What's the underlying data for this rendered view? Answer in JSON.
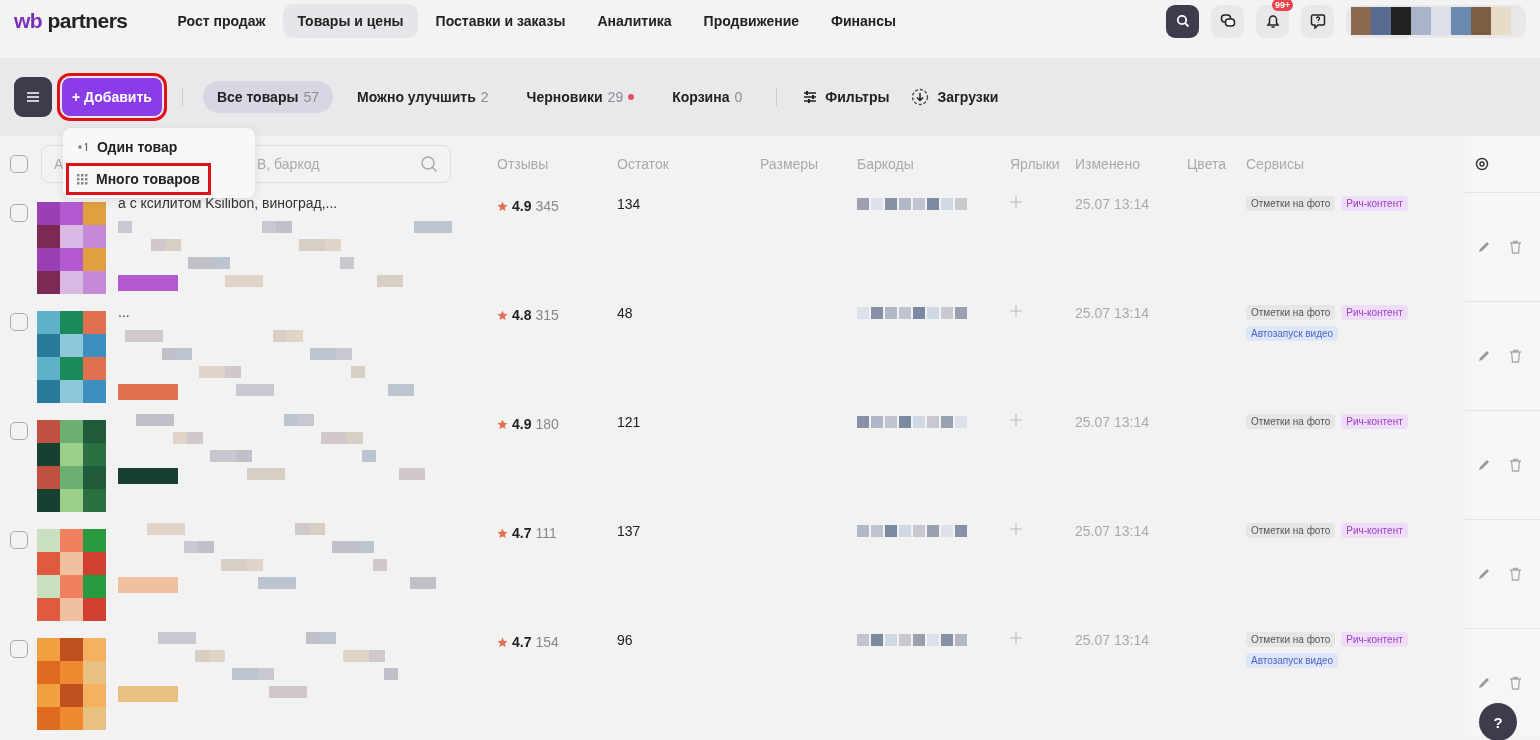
{
  "logo": {
    "mark": "wb",
    "name": "partners"
  },
  "nav": [
    {
      "label": "Рост продаж",
      "selected": false
    },
    {
      "label": "Товары и цены",
      "selected": true
    },
    {
      "label": "Поставки и заказы",
      "selected": false
    },
    {
      "label": "Аналитика",
      "selected": false
    },
    {
      "label": "Продвижение",
      "selected": false
    },
    {
      "label": "Финансы",
      "selected": false
    }
  ],
  "notifications": {
    "badge": "99+"
  },
  "add_button": {
    "label": "+ Добавить",
    "highlighted": true
  },
  "filters": [
    {
      "label": "Все товары",
      "count": "57",
      "selected": true,
      "dot": false
    },
    {
      "label": "Можно улучшить",
      "count": "2",
      "selected": false,
      "dot": false
    },
    {
      "label": "Черновики",
      "count": "29",
      "selected": false,
      "dot": true
    },
    {
      "label": "Корзина",
      "count": "0",
      "selected": false,
      "dot": false
    }
  ],
  "tools": [
    {
      "label": "Фильтры",
      "kind": "filter"
    },
    {
      "label": "Загрузки",
      "kind": "download"
    }
  ],
  "add_menu": [
    {
      "label": "Один товар",
      "kind": "single",
      "highlighted": false
    },
    {
      "label": "Много товаров",
      "kind": "many",
      "highlighted": true
    }
  ],
  "select_all": {
    "checked": false
  },
  "search": {
    "placeholder_start": "А",
    "placeholder_end": "В, баркод"
  },
  "table": {
    "columns": [
      "Отзывы",
      "Остаток",
      "Размеры",
      "Баркоды",
      "Ярлыки",
      "Изменено",
      "Цвета",
      "Сервисы"
    ],
    "rows": [
      {
        "checked": false,
        "title": "а с ксилитом Ksilibon, виноград,...",
        "rating": "4.9",
        "reviews": "345",
        "stock": "134",
        "changed": "25.07 13:14",
        "services": [
          {
            "label": "Отметки на фото",
            "kind": "grey"
          },
          {
            "label": "Рич-контент",
            "kind": "purple"
          }
        ]
      },
      {
        "checked": false,
        "title": "...",
        "rating": "4.8",
        "reviews": "315",
        "stock": "48",
        "changed": "25.07 13:14",
        "services": [
          {
            "label": "Отметки на фото",
            "kind": "grey"
          },
          {
            "label": "Рич-контент",
            "kind": "purple"
          },
          {
            "label": "Автозапуск видео",
            "kind": "blue"
          }
        ]
      },
      {
        "checked": false,
        "title": "",
        "rating": "4.9",
        "reviews": "180",
        "stock": "121",
        "changed": "25.07 13:14",
        "services": [
          {
            "label": "Отметки на фото",
            "kind": "grey"
          },
          {
            "label": "Рич-контент",
            "kind": "purple"
          }
        ]
      },
      {
        "checked": false,
        "title": "",
        "rating": "4.7",
        "reviews": "111",
        "stock": "137",
        "changed": "25.07 13:14",
        "services": [
          {
            "label": "Отметки на фото",
            "kind": "grey"
          },
          {
            "label": "Рич-контент",
            "kind": "purple"
          }
        ]
      },
      {
        "checked": false,
        "title": "",
        "rating": "4.7",
        "reviews": "154",
        "stock": "96",
        "changed": "25.07 13:14",
        "services": [
          {
            "label": "Отметки на фото",
            "kind": "grey"
          },
          {
            "label": "Рич-контент",
            "kind": "purple"
          },
          {
            "label": "Автозапуск видео",
            "kind": "blue"
          }
        ]
      }
    ]
  },
  "help": {
    "label": "?"
  }
}
